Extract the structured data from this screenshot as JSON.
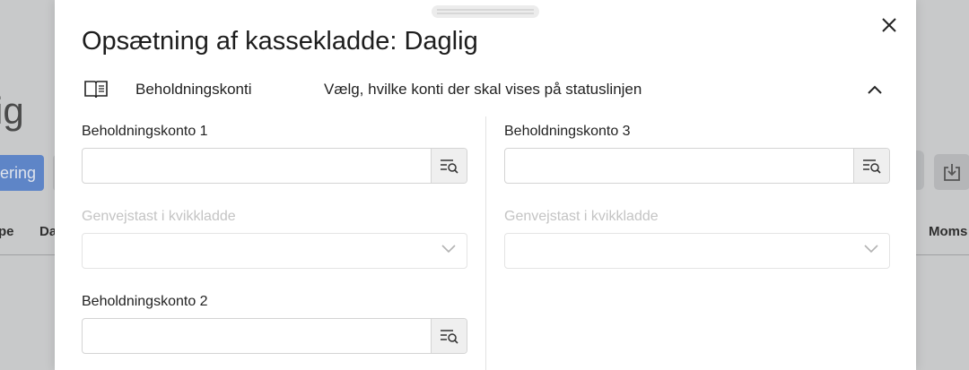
{
  "background": {
    "title_fragment": "ig",
    "button_fragment": "ering",
    "columns": {
      "col1": "pe",
      "col2": "Da",
      "col3": "Moms"
    }
  },
  "modal": {
    "title": "Opsætning af kassekladde: Daglig",
    "section": {
      "icon": "book-icon",
      "label": "Beholdningskonti",
      "description": "Vælg, hvilke konti der skal vises på statuslinjen"
    },
    "fields": {
      "account1": {
        "label": "Beholdningskonto 1",
        "value": ""
      },
      "shortcut1": {
        "label": "Genvejstast i kvikkladde",
        "value": ""
      },
      "account2": {
        "label": "Beholdningskonto 2",
        "value": ""
      },
      "account3": {
        "label": "Beholdningskonto 3",
        "value": ""
      },
      "shortcut3": {
        "label": "Genvejstast i kvikkladde",
        "value": ""
      }
    }
  },
  "colors": {
    "accent": "#3b6fc6",
    "overlay": "#c8c9ca",
    "disabled_text": "#c4c4c4"
  }
}
